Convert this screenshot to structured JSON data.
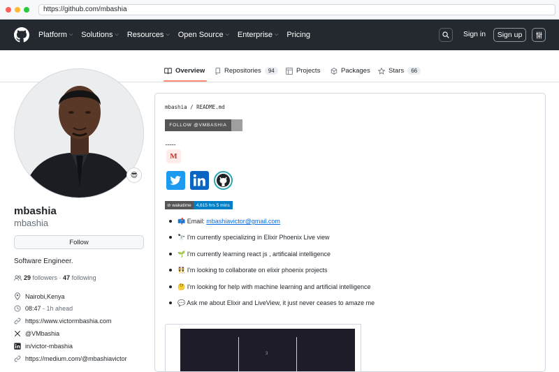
{
  "browser": {
    "url": "https://github.com/mbashia"
  },
  "nav": {
    "items": [
      "Platform",
      "Solutions",
      "Resources",
      "Open Source",
      "Enterprise",
      "Pricing"
    ],
    "signin": "Sign in",
    "signup": "Sign up"
  },
  "tabs": [
    {
      "label": "Overview",
      "icon": "book-icon",
      "active": true
    },
    {
      "label": "Repositories",
      "icon": "repo-icon",
      "count": "94"
    },
    {
      "label": "Projects",
      "icon": "table-icon"
    },
    {
      "label": "Packages",
      "icon": "package-icon"
    },
    {
      "label": "Stars",
      "icon": "star-icon",
      "count": "66"
    }
  ],
  "profile": {
    "fullname": "mbashia",
    "username": "mbashia",
    "status_emoji": "😎",
    "follow": "Follow",
    "bio": "Software Engineer.",
    "followers": "29",
    "followers_label": "followers",
    "following": "47",
    "following_label": "following",
    "location": "Nairobi,Kenya",
    "time": "08:47",
    "time_note": "- 1h ahead",
    "website": "https://www.victormbashia.com",
    "twitter": "@VMbashia",
    "linkedin": "in/victor-mbashia",
    "medium": "https://medium.com/@mbashiavictor"
  },
  "readme": {
    "owner": "mbashia",
    "file": "README.md",
    "follow_badge": "FOLLOW @VMBASHIA",
    "dots": "..........",
    "medium_letter": "M",
    "wakatime_label": "wakatime",
    "wakatime_value": "4,615 hrs 5 mins",
    "email_prefix": "📫 Email: ",
    "email": "mbashiavictor@gmail.com",
    "bullets": [
      "🔭 I'm currently specializing in Elixir Phoenix Live view",
      "🌱 I'm currently learning react js , artificaial intelligence",
      "👯 I'm looking to collaborate on elixir phoenix projects",
      "🤔 I'm looking for help with machine learning and artificial intelligence",
      "💬 Ask me about Elixir and LiveView, it just never ceases to amaze me"
    ],
    "stats_number": "3"
  },
  "colors": {
    "nav_bg": "#24292f",
    "accent_underline": "#fd8c73",
    "link": "#0969da",
    "twitter": "#1d9bf0",
    "linkedin": "#0a66c2"
  }
}
